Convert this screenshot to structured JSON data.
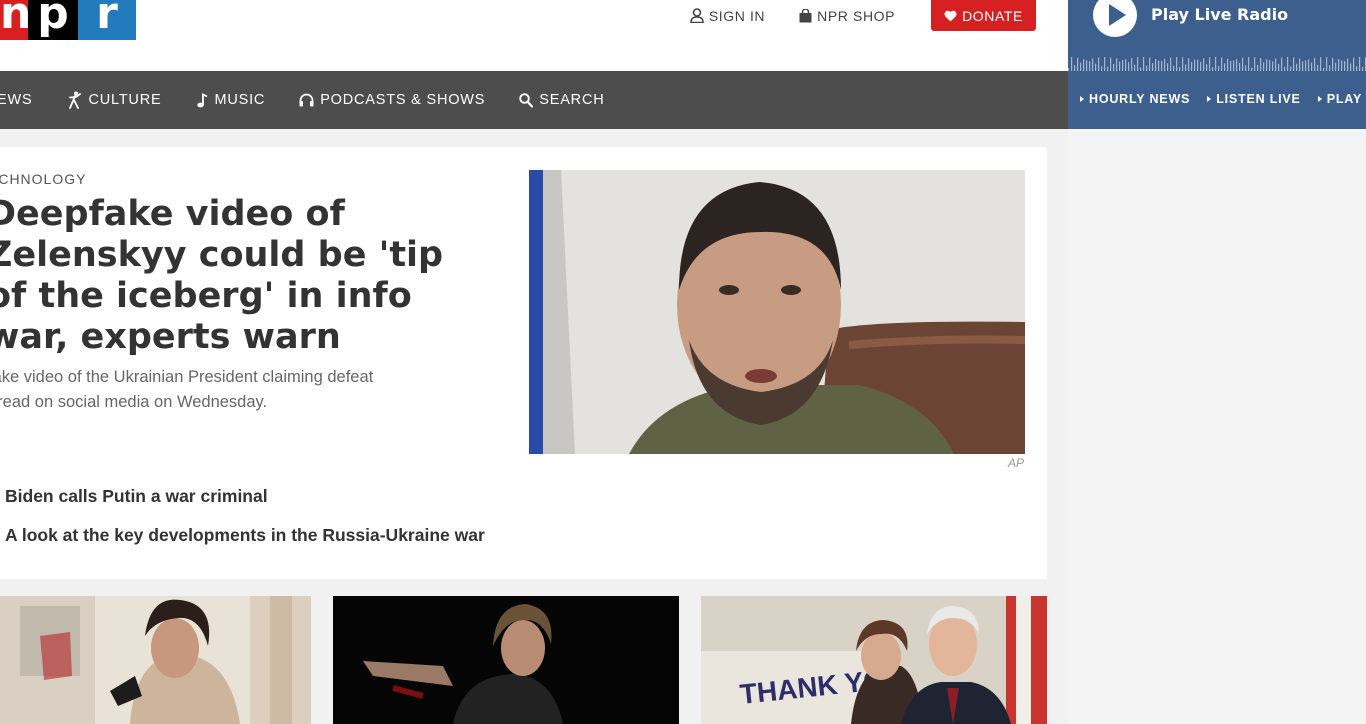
{
  "header": {
    "logo_letters": [
      "n",
      "p",
      "r"
    ],
    "sign_in": "SIGN IN",
    "shop": "NPR SHOP",
    "donate": "DONATE"
  },
  "nav": {
    "news": "EWS",
    "culture": "CULTURE",
    "music": "MUSIC",
    "podcasts": "PODCASTS & SHOWS",
    "search": "SEARCH"
  },
  "radio": {
    "title": "Play Live Radio",
    "links": [
      "HOURLY NEWS",
      "LISTEN LIVE",
      "PLAY"
    ]
  },
  "story": {
    "section": "ECHNOLOGY",
    "headline_lines": [
      "Deepfake video of",
      "Zelenskyy could be 'tip",
      "of the iceberg' in info",
      "war, experts warn"
    ],
    "teaser_lines": [
      "fake video of the Ukrainian President claiming defeat",
      "pread on social media on Wednesday."
    ],
    "photo_credit": "AP",
    "related": [
      "Biden calls Putin a war criminal",
      "A look at the key developments in the Russia-Ukraine war"
    ]
  },
  "thumbnails": {
    "t3_sign_text": "THANK YOU"
  },
  "colors": {
    "npr_red": "#d62021",
    "npr_blue": "#237bbd",
    "nav_bg": "#4d4d4d",
    "radio_bg": "#3d5f8d"
  }
}
